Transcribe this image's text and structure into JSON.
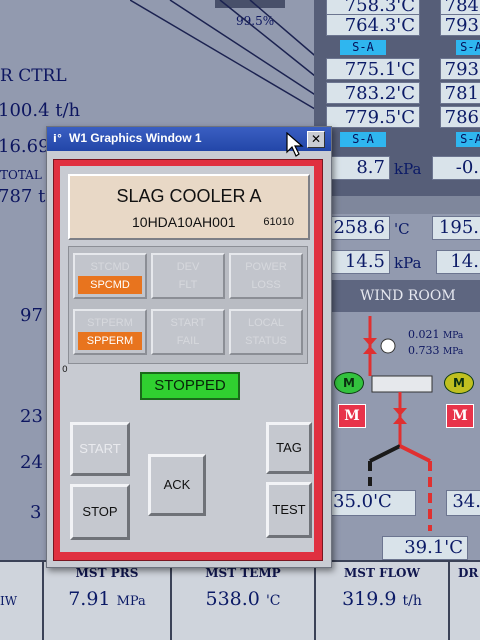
{
  "background": {
    "top_left_pct": "99.5%",
    "ctrl_label": "R CTRL",
    "left_value_1": "100.4 t/h",
    "left_value_2": "16.69",
    "total_label": "TOTAL",
    "left_value_3": "787 t",
    "left_value_4": "97",
    "left_value_5": "23",
    "left_value_6": "24",
    "left_value_7": "3",
    "col1_values": [
      "758.3'C",
      "764.3'C",
      "775.1'C",
      "783.2'C",
      "779.5'C"
    ],
    "col2_values": [
      "784",
      "793",
      "793",
      "781",
      "786"
    ],
    "sa_label": "S-A",
    "pressure_1": "8.7",
    "pressure_1_unit": "kPa",
    "pressure_2": "-0.",
    "temp_a": "258.6",
    "temp_a_unit": "'C",
    "temp_b": "195.",
    "pressure_3": "14.5",
    "pressure_3_unit": "kPa",
    "pressure_4": "14.",
    "wind_room": "WIND ROOM",
    "mpa_1": "0.021",
    "mpa_2": "0.733",
    "mpa_unit": "MPa",
    "motor_m": "M",
    "temp_c": "35.0'C",
    "temp_d": "34.",
    "temp_e": "39.1'C"
  },
  "bottom_bar": {
    "col0_unit": "IW",
    "items": [
      {
        "label": "MST PRS",
        "value": "7.91",
        "unit": "MPa"
      },
      {
        "label": "MST TEMP",
        "value": "538.0",
        "unit": "'C"
      },
      {
        "label": "MST FLOW",
        "value": "319.9",
        "unit": "t/h"
      },
      {
        "label": "DR",
        "value": "",
        "unit": ""
      }
    ]
  },
  "window": {
    "title": "W1 Graphics Window 1",
    "icon": "i°",
    "close": "✕",
    "equipment_name": "SLAG COOLER A",
    "tag": "10HDA10AH001",
    "code": "61010",
    "indicators": [
      {
        "top": "STCMD",
        "bottom": "SPCMD",
        "top_on": false,
        "bottom_on": true
      },
      {
        "top": "DEV",
        "bottom": "FLT",
        "top_on": false,
        "bottom_on": false
      },
      {
        "top": "POWER",
        "bottom": "LOSS",
        "top_on": false,
        "bottom_on": false
      },
      {
        "top": "STPERM",
        "bottom": "SPPERM",
        "top_on": false,
        "bottom_on": true
      },
      {
        "top": "START",
        "bottom": "FAIL",
        "top_on": false,
        "bottom_on": false
      },
      {
        "top": "LOCAL",
        "bottom": "STATUS",
        "top_on": false,
        "bottom_on": false
      }
    ],
    "zero_label": "0",
    "status": "STOPPED",
    "status_color": "#30d030",
    "buttons": {
      "start": "START",
      "stop": "STOP",
      "ack": "ACK",
      "tag": "TAG",
      "test": "TEST"
    }
  },
  "colors": {
    "frame_red": "#e03040",
    "indicator_on": "#e8741e",
    "sa_blue": "#2fb6ef",
    "titlebar_blue": "#2346a8"
  }
}
